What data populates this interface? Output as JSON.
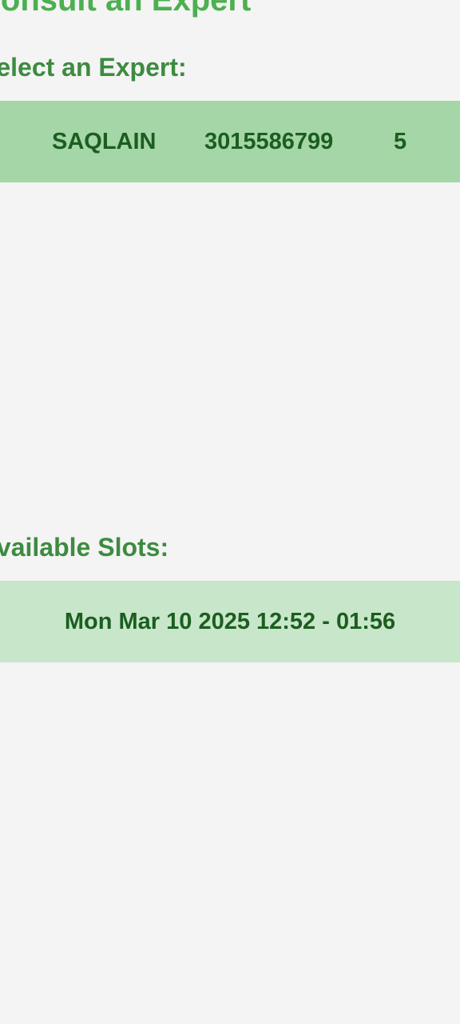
{
  "header": {
    "title": "Consult an Expert"
  },
  "experts_section": {
    "label": "Select an Expert:",
    "experts": [
      {
        "name": "SAQLAIN",
        "phone": "3015586799",
        "rating": "5"
      }
    ]
  },
  "slots_section": {
    "label": "Available Slots:",
    "slots": [
      {
        "text": "Mon Mar 10 2025 12:52 - 01:56"
      }
    ]
  },
  "colors": {
    "background": "#f4f4f4",
    "title": "#4caf50",
    "label": "#3d8b40",
    "expert_row": "#a5d6a7",
    "slot_row": "#c8e6c9",
    "row_text": "#1b5e20"
  }
}
